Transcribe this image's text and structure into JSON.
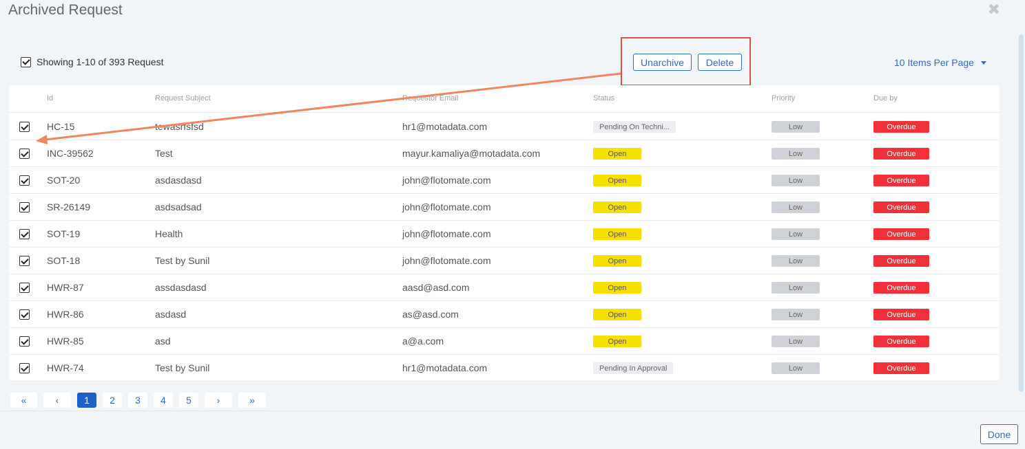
{
  "modal": {
    "title": "Archived Request",
    "close_icon": "close-icon",
    "done_label": "Done"
  },
  "toolbar": {
    "showing_text": "Showing 1-10 of 393 Request",
    "unarchive_label": "Unarchive",
    "delete_label": "Delete",
    "items_per_page": "10 Items Per Page"
  },
  "table": {
    "headers": [
      "Id",
      "Request Subject",
      "Requestor Email",
      "Status",
      "Priority",
      "Due by"
    ],
    "rows": [
      {
        "id": "HC-15",
        "subject": "tewasrfsfsd",
        "email": "hr1@motadata.com",
        "status": "Pending On Techni...",
        "status_kind": "pending",
        "priority": "Low",
        "due": "Overdue"
      },
      {
        "id": "INC-39562",
        "subject": "Test",
        "email": "mayur.kamaliya@motadata.com",
        "status": "Open",
        "status_kind": "open",
        "priority": "Low",
        "due": "Overdue"
      },
      {
        "id": "SOT-20",
        "subject": "asdasdasd",
        "email": "john@flotomate.com",
        "status": "Open",
        "status_kind": "open",
        "priority": "Low",
        "due": "Overdue"
      },
      {
        "id": "SR-26149",
        "subject": "asdsadsad",
        "email": "john@flotomate.com",
        "status": "Open",
        "status_kind": "open",
        "priority": "Low",
        "due": "Overdue"
      },
      {
        "id": "SOT-19",
        "subject": "Health",
        "email": "john@flotomate.com",
        "status": "Open",
        "status_kind": "open",
        "priority": "Low",
        "due": "Overdue"
      },
      {
        "id": "SOT-18",
        "subject": "Test by Sunil",
        "email": "john@flotomate.com",
        "status": "Open",
        "status_kind": "open",
        "priority": "Low",
        "due": "Overdue"
      },
      {
        "id": "HWR-87",
        "subject": "assdasdasd",
        "email": "aasd@asd.com",
        "status": "Open",
        "status_kind": "open",
        "priority": "Low",
        "due": "Overdue"
      },
      {
        "id": "HWR-86",
        "subject": "asdasd",
        "email": "as@asd.com",
        "status": "Open",
        "status_kind": "open",
        "priority": "Low",
        "due": "Overdue"
      },
      {
        "id": "HWR-85",
        "subject": "asd",
        "email": "a@a.com",
        "status": "Open",
        "status_kind": "open",
        "priority": "Low",
        "due": "Overdue"
      },
      {
        "id": "HWR-74",
        "subject": "Test by Sunil",
        "email": "hr1@motadata.com",
        "status": "Pending In Approval",
        "status_kind": "pending",
        "priority": "Low",
        "due": "Overdue"
      }
    ]
  },
  "pagination": {
    "first": "«",
    "prev": "‹",
    "next": "›",
    "last": "»",
    "pages": [
      "1",
      "2",
      "3",
      "4",
      "5"
    ],
    "active_page": "1"
  },
  "colors": {
    "accent": "#2e6ac8",
    "status_open": "#f7e000",
    "overdue": "#f2303a",
    "annotation": "#e04b4b",
    "arrow": "#f08560"
  }
}
